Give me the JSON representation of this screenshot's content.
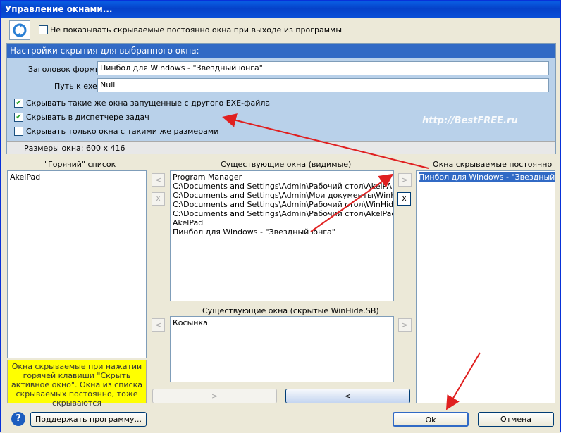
{
  "window": {
    "title": "Управление окнами..."
  },
  "top": {
    "dont_show_label": "Не показывать скрываемые постоянно окна при выходе из программы"
  },
  "settings": {
    "header": "Настройки скрытия для выбранного окна:",
    "form_title_label": "Заголовок формы:",
    "form_title_value": "Пинбол для Windows - \"Звездный юнга\"",
    "exe_path_label": "Путь к exe:",
    "exe_path_value": "Null",
    "hide_same_exe_label": "Скрывать такие же окна запущенные с другого EXE-файла",
    "hide_same_exe_checked": true,
    "hide_taskmgr_label": "Скрывать в диспетчере задач",
    "hide_taskmgr_checked": true,
    "hide_same_size_label": "Скрывать только окна с такими же размерами",
    "hide_same_size_checked": false,
    "window_size": "Размеры окна: 600 x 416",
    "watermark": "http://BestFREE.ru"
  },
  "hot_list": {
    "title": "\"Горячий\" список",
    "items": [
      "AkelPad"
    ]
  },
  "visible_windows": {
    "title": "Существующие окна (видимые)",
    "items": [
      "Program Manager",
      "C:\\Documents and Settings\\Admin\\Рабочий стол\\AkelPAD ZVER",
      "C:\\Documents and Settings\\Admin\\Мои документы\\WinHide.SB",
      "C:\\Documents and Settings\\Admin\\Рабочий стол\\WinHide.SB",
      "C:\\Documents and Settings\\Admin\\Рабочий стол\\AkelPad_Image",
      "AkelPad",
      "Пинбол для Windows - \"Звездный юнга\""
    ]
  },
  "hidden_windows": {
    "title": "Существующие окна (скрытые WinHide.SB)",
    "items": [
      "Косынка"
    ]
  },
  "permanent_hidden": {
    "title": "Окна скрываемые постоянно",
    "items": [
      "Пинбол для Windows - \"Звездный юнга\""
    ]
  },
  "buttons": {
    "left": "<",
    "right": ">",
    "remove": "X",
    "bottom_right": ">",
    "bottom_left": "<",
    "support": "Поддержать программу...",
    "ok": "Ok",
    "cancel": "Отмена",
    "help": "?"
  },
  "info_note": "Окна скрываемые при нажатии горячей клавиши \"Скрыть активное окно\". Окна из списка скрываемых постоянно, тоже скрываются",
  "colors": {
    "titlebar": "#0542c9",
    "panel": "#b9d1ea",
    "selection": "#316ac5",
    "note": "#ffff00",
    "arrow": "#e02020"
  }
}
